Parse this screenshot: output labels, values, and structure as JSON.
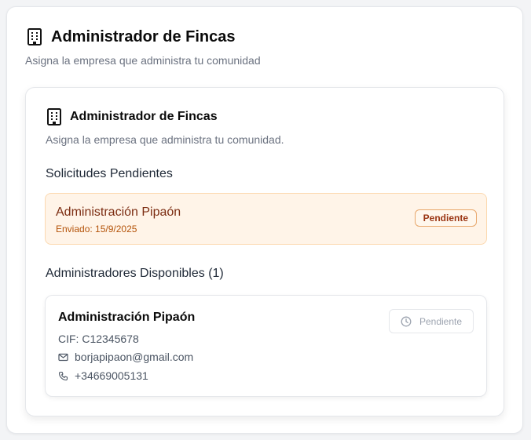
{
  "header": {
    "title": "Administrador de Fincas",
    "subtitle": "Asigna la empresa que administra tu comunidad",
    "icon": "building-icon"
  },
  "card": {
    "title": "Administrador de Fincas",
    "subtitle": "Asigna la empresa que administra tu comunidad.",
    "icon": "building-icon"
  },
  "pending_section": {
    "title": "Solicitudes Pendientes",
    "requests": [
      {
        "name": "Administración Pipaón",
        "sent": "Enviado: 15/9/2025",
        "badge": "Pendiente"
      }
    ]
  },
  "available_section": {
    "title": "Administradores Disponibles (1)",
    "admins": [
      {
        "name": "Administración Pipaón",
        "cif": "CIF: C12345678",
        "email": "borjapipaon@gmail.com",
        "phone": "+34669005131",
        "status_label": "Pendiente",
        "status_icon": "clock-icon"
      }
    ]
  },
  "colors": {
    "pending_bg": "#fff4e8",
    "pending_border": "#fcd9b0",
    "pending_text": "#7c2d12",
    "badge_border": "#e8a76b"
  }
}
